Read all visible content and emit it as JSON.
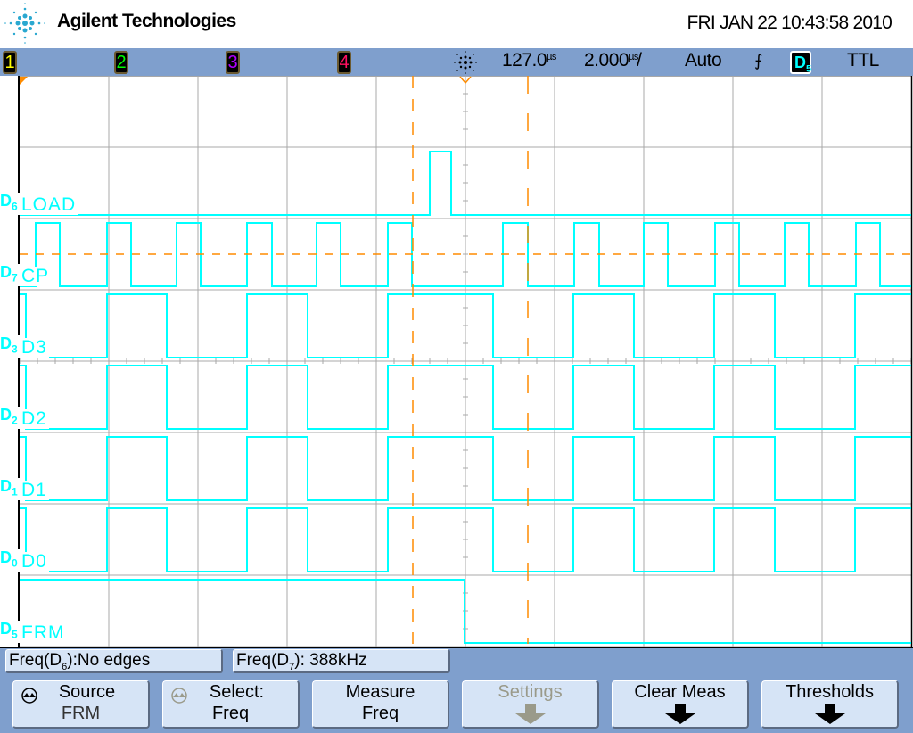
{
  "header": {
    "brand": "Agilent Technologies",
    "datetime": "FRI JAN 22 10:43:58 2010"
  },
  "status_bar": {
    "channels": [
      {
        "label": "1",
        "color": "#ffff00"
      },
      {
        "label": "2",
        "color": "#00ff00"
      },
      {
        "label": "3",
        "color": "#b000ff"
      },
      {
        "label": "4",
        "color": "#ff1060"
      }
    ],
    "delay_value": "127.0",
    "delay_unit": "µs",
    "timebase_value": "2.000",
    "timebase_unit": "µs",
    "timebase_suffix": "/",
    "trigger_mode": "Auto",
    "trigger_slope_symbol": "⨍",
    "trigger_source": "D",
    "trigger_source_sub": "5",
    "trigger_level": "TTL"
  },
  "traces": [
    {
      "ch": "D",
      "sub": "6",
      "name": "LOAD",
      "start_high": false,
      "edges_us": [
        -0.8,
        -0.32
      ]
    },
    {
      "ch": "D",
      "sub": "7",
      "name": "CP",
      "start_high": false,
      "edges_us": [
        -9.64,
        -9.1,
        -8.04,
        -7.5,
        -6.48,
        -5.94,
        -4.9,
        -4.34,
        -3.34,
        -2.8,
        -1.74,
        -1.2,
        0.84,
        1.4,
        2.44,
        3.0,
        4.0,
        4.54,
        5.6,
        6.14,
        7.16,
        7.7,
        8.76,
        9.3
      ]
    },
    {
      "ch": "D",
      "sub": "3",
      "name": "D3",
      "start_high": true,
      "edges_us": [
        -9.86,
        -8.04,
        -6.7,
        -4.9,
        -3.54,
        -1.74,
        0.62,
        2.42,
        3.78,
        5.58,
        6.94,
        8.74
      ]
    },
    {
      "ch": "D",
      "sub": "2",
      "name": "D2",
      "start_high": true,
      "edges_us": [
        -9.86,
        -8.04,
        -6.7,
        -4.9,
        -3.54,
        -1.74,
        0.62,
        2.42,
        3.78,
        5.58,
        6.94,
        8.74
      ]
    },
    {
      "ch": "D",
      "sub": "1",
      "name": "D1",
      "start_high": true,
      "edges_us": [
        -9.86,
        -8.04,
        -6.7,
        -4.9,
        -3.54,
        -1.74,
        0.62,
        2.42,
        3.78,
        5.58,
        6.94,
        8.74
      ]
    },
    {
      "ch": "D",
      "sub": "0",
      "name": "D0",
      "start_high": true,
      "edges_us": [
        -9.86,
        -8.04,
        -6.7,
        -4.9,
        -3.54,
        -1.74,
        0.62,
        2.42,
        3.78,
        5.58,
        6.94,
        8.74
      ]
    },
    {
      "ch": "D",
      "sub": "5",
      "name": "FRM",
      "start_high": true,
      "edges_us": [
        -0.02
      ]
    }
  ],
  "time_window_us": [
    -10,
    10
  ],
  "cursors_us": [
    -1.18,
    1.4
  ],
  "colors": {
    "trace": "#00ffff",
    "cursor": "#ff8c00",
    "grid": "#a8a8a8",
    "bar": "#7f9fcd"
  },
  "measurements": [
    {
      "prefix": "Freq(",
      "ch": "D",
      "sub": "6",
      "suffix": "):No edges"
    },
    {
      "prefix": "Freq(",
      "ch": "D",
      "sub": "7",
      "suffix": "): 388kHz"
    }
  ],
  "softkeys": [
    {
      "line1": "Source",
      "line2": "FRM",
      "icon": "rotate-knob-icon"
    },
    {
      "line1": "Select:",
      "line2": "Freq",
      "icon": "rotate-knob-icon"
    },
    {
      "line1": "Measure",
      "line2": "Freq"
    },
    {
      "line1": "Settings",
      "icon": "down-arrow-icon",
      "disabled": true
    },
    {
      "line1": "Clear Meas",
      "icon": "down-arrow-icon"
    },
    {
      "line1": "Thresholds",
      "icon": "down-arrow-icon"
    }
  ]
}
